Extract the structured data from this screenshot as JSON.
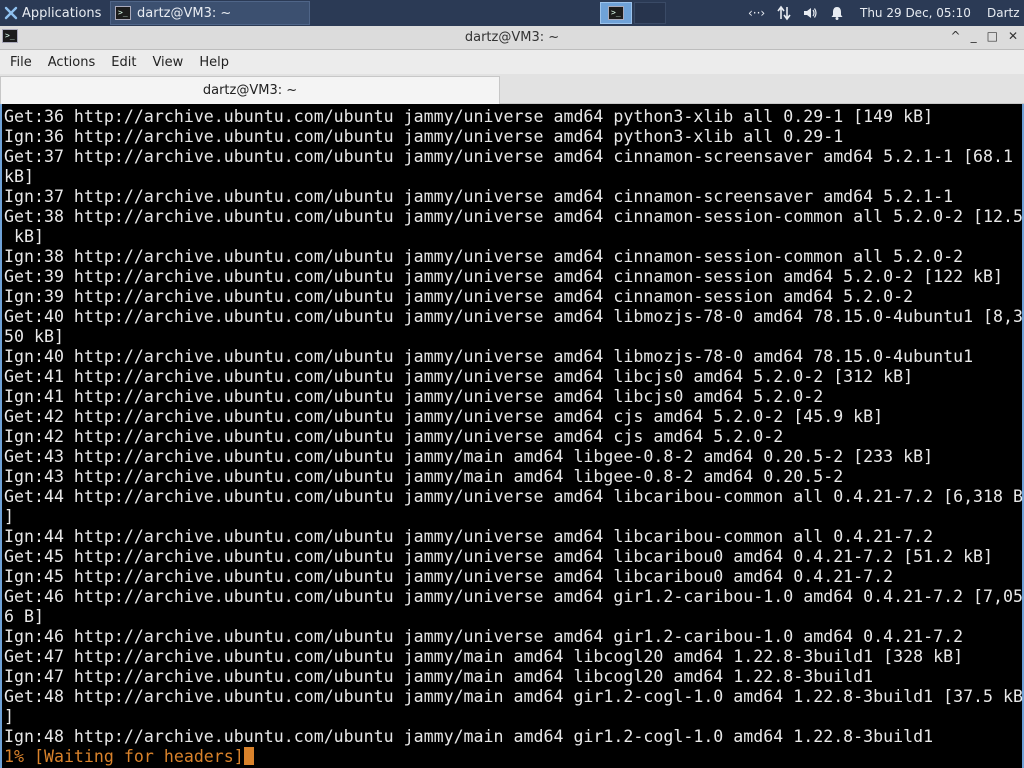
{
  "panel": {
    "apps_label": "Applications",
    "task_label": "dartz@VM3: ~",
    "datetime": "Thu 29 Dec, 05:10",
    "user": "Dartz",
    "tray_net": "‹··›"
  },
  "window": {
    "title": "dartz@VM3: ~",
    "controls": {
      "shade": "^",
      "minimize": "_",
      "maximize": "□",
      "close": "✕"
    }
  },
  "menu": {
    "file": "File",
    "actions": "Actions",
    "edit": "Edit",
    "view": "View",
    "help": "Help"
  },
  "tab": {
    "label": "dartz@VM3: ~"
  },
  "terminal": {
    "lines": [
      "Get:36 http://archive.ubuntu.com/ubuntu jammy/universe amd64 python3-xlib all 0.29-1 [149 kB]",
      "Ign:36 http://archive.ubuntu.com/ubuntu jammy/universe amd64 python3-xlib all 0.29-1",
      "Get:37 http://archive.ubuntu.com/ubuntu jammy/universe amd64 cinnamon-screensaver amd64 5.2.1-1 [68.1",
      "kB]",
      "Ign:37 http://archive.ubuntu.com/ubuntu jammy/universe amd64 cinnamon-screensaver amd64 5.2.1-1",
      "Get:38 http://archive.ubuntu.com/ubuntu jammy/universe amd64 cinnamon-session-common all 5.2.0-2 [12.5",
      " kB]",
      "Ign:38 http://archive.ubuntu.com/ubuntu jammy/universe amd64 cinnamon-session-common all 5.2.0-2",
      "Get:39 http://archive.ubuntu.com/ubuntu jammy/universe amd64 cinnamon-session amd64 5.2.0-2 [122 kB]",
      "Ign:39 http://archive.ubuntu.com/ubuntu jammy/universe amd64 cinnamon-session amd64 5.2.0-2",
      "Get:40 http://archive.ubuntu.com/ubuntu jammy/universe amd64 libmozjs-78-0 amd64 78.15.0-4ubuntu1 [8,3",
      "50 kB]",
      "Ign:40 http://archive.ubuntu.com/ubuntu jammy/universe amd64 libmozjs-78-0 amd64 78.15.0-4ubuntu1",
      "Get:41 http://archive.ubuntu.com/ubuntu jammy/universe amd64 libcjs0 amd64 5.2.0-2 [312 kB]",
      "Ign:41 http://archive.ubuntu.com/ubuntu jammy/universe amd64 libcjs0 amd64 5.2.0-2",
      "Get:42 http://archive.ubuntu.com/ubuntu jammy/universe amd64 cjs amd64 5.2.0-2 [45.9 kB]",
      "Ign:42 http://archive.ubuntu.com/ubuntu jammy/universe amd64 cjs amd64 5.2.0-2",
      "Get:43 http://archive.ubuntu.com/ubuntu jammy/main amd64 libgee-0.8-2 amd64 0.20.5-2 [233 kB]",
      "Ign:43 http://archive.ubuntu.com/ubuntu jammy/main amd64 libgee-0.8-2 amd64 0.20.5-2",
      "Get:44 http://archive.ubuntu.com/ubuntu jammy/universe amd64 libcaribou-common all 0.4.21-7.2 [6,318 B",
      "]",
      "Ign:44 http://archive.ubuntu.com/ubuntu jammy/universe amd64 libcaribou-common all 0.4.21-7.2",
      "Get:45 http://archive.ubuntu.com/ubuntu jammy/universe amd64 libcaribou0 amd64 0.4.21-7.2 [51.2 kB]",
      "Ign:45 http://archive.ubuntu.com/ubuntu jammy/universe amd64 libcaribou0 amd64 0.4.21-7.2",
      "Get:46 http://archive.ubuntu.com/ubuntu jammy/universe amd64 gir1.2-caribou-1.0 amd64 0.4.21-7.2 [7,05",
      "6 B]",
      "Ign:46 http://archive.ubuntu.com/ubuntu jammy/universe amd64 gir1.2-caribou-1.0 amd64 0.4.21-7.2",
      "Get:47 http://archive.ubuntu.com/ubuntu jammy/main amd64 libcogl20 amd64 1.22.8-3build1 [328 kB]",
      "Ign:47 http://archive.ubuntu.com/ubuntu jammy/main amd64 libcogl20 amd64 1.22.8-3build1",
      "Get:48 http://archive.ubuntu.com/ubuntu jammy/main amd64 gir1.2-cogl-1.0 amd64 1.22.8-3build1 [37.5 kB",
      "]",
      "Ign:48 http://archive.ubuntu.com/ubuntu jammy/main amd64 gir1.2-cogl-1.0 amd64 1.22.8-3build1"
    ],
    "status_line": "1% [Waiting for headers]"
  }
}
